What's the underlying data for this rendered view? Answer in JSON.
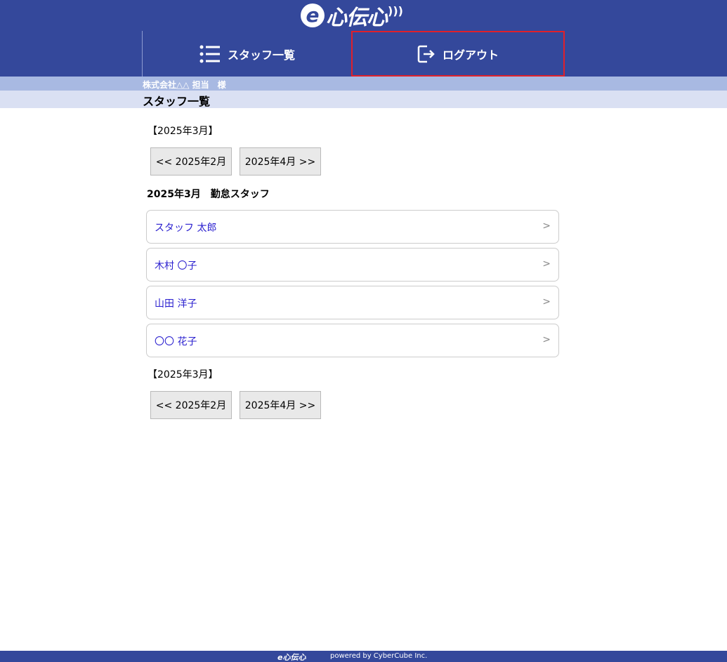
{
  "header": {
    "logo_text": "心伝心",
    "nav": {
      "staff_label": "スタッフ一覧",
      "logout_label": "ログアウト"
    }
  },
  "company_line": "株式会社△△ 担当　様",
  "page_title": "スタッフ一覧",
  "top_nav": {
    "month_label": "【2025年3月】",
    "prev_button": "<< 2025年2月",
    "next_button": "2025年4月 >>"
  },
  "section_heading": "2025年3月　勤怠スタッフ",
  "staff": [
    {
      "name": "スタッフ 太郎"
    },
    {
      "name": "木村 〇子"
    },
    {
      "name": "山田 洋子"
    },
    {
      "name": "〇〇 花子"
    }
  ],
  "bottom_nav": {
    "month_label": "【2025年3月】",
    "prev_button": "<< 2025年2月",
    "next_button": "2025年4月 >>"
  },
  "footer": {
    "logo_text": "心伝心",
    "powered_text": "powered by  CyberCube Inc."
  },
  "colors": {
    "header_bg": "#34489b",
    "company_bar_bg": "#a8b9e2",
    "title_bar_bg": "#dae0f3",
    "link_color": "#2a1fcf",
    "highlight_border": "#e0202a"
  }
}
